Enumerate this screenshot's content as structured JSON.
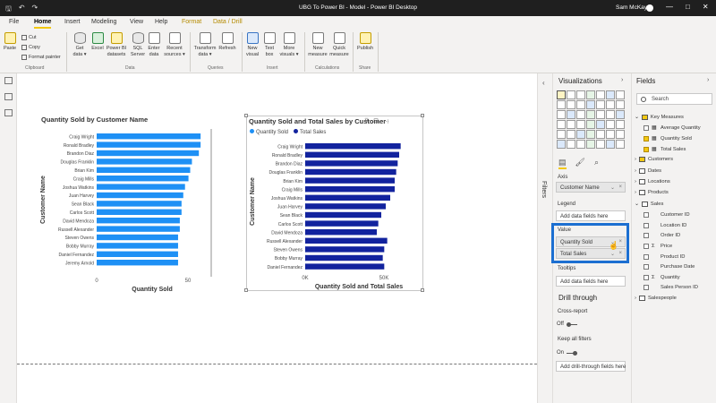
{
  "window": {
    "title": "UBG To Power BI - Model - Power BI Desktop",
    "user": "Sam McKay",
    "controls": [
      "—",
      "□",
      "✕"
    ]
  },
  "menu": {
    "tabs": [
      "File",
      "Home",
      "Insert",
      "Modeling",
      "View",
      "Help",
      "Format",
      "Data / Drill"
    ]
  },
  "ribbon": {
    "clipboard": {
      "paste": "Paste",
      "cut": "Cut",
      "copy": "Copy",
      "format_painter": "Format painter",
      "group": "Clipboard"
    },
    "data": {
      "buttons": [
        {
          "label": "Get\ndata ▾"
        },
        {
          "label": "Excel"
        },
        {
          "label": "Power BI\ndatasets"
        },
        {
          "label": "SQL\nServer"
        },
        {
          "label": "Enter\ndata"
        },
        {
          "label": "Recent\nsources ▾"
        }
      ],
      "group": "Data"
    },
    "queries": {
      "transform": "Transform\ndata ▾",
      "refresh": "Refresh",
      "group": "Queries"
    },
    "insert": {
      "new_visual": "New\nvisual",
      "text_box": "Text\nbox",
      "more_visuals": "More\nvisuals ▾",
      "group": "Insert"
    },
    "calculations": {
      "new_measure": "New\nmeasure",
      "quick_measure": "Quick\nmeasure",
      "group": "Calculations"
    },
    "share": {
      "publish": "Publish",
      "group": "Share"
    }
  },
  "chart1": {
    "title": "Quantity Sold by Customer Name",
    "ylabel": "Customer Name",
    "xlabel": "Quantity Sold",
    "ticks": [
      "0",
      "50"
    ]
  },
  "chart2": {
    "title": "Quantity Sold and Total Sales by Customer Name",
    "ylabel": "Customer Name",
    "xlabel": "Quantity Sold and Total Sales",
    "ticks": [
      "0K",
      "50K"
    ],
    "legend": [
      "Quantity Sold",
      "Total Sales"
    ]
  },
  "chart_data": [
    {
      "type": "bar",
      "orientation": "horizontal",
      "title": "Quantity Sold by Customer Name",
      "xlabel": "Quantity Sold",
      "ylabel": "Customer Name",
      "categories": [
        "Craig Wright",
        "Ronald Bradley",
        "Brandon Diaz",
        "Douglas Franklin",
        "Brian Kim",
        "Craig Mills",
        "Joshua Watkins",
        "Juan Harvey",
        "Sean Black",
        "Carlos Scott",
        "David Mendoza",
        "Russell Alexander",
        "Steven Owens",
        "Bobby Murray",
        "Daniel Fernandez",
        "Jeremy Arnold"
      ],
      "values": [
        60,
        60,
        59,
        55,
        54,
        53,
        51,
        50,
        49,
        49,
        48,
        48,
        47,
        47,
        47,
        47
      ],
      "xlim": [
        0,
        62
      ],
      "color": "#1e90f5"
    },
    {
      "type": "bar",
      "orientation": "horizontal",
      "title": "Quantity Sold and Total Sales by Customer Name",
      "xlabel": "Quantity Sold and Total Sales",
      "ylabel": "Customer Name",
      "categories": [
        "Craig Wright",
        "Ronald Bradley",
        "Brandon Diaz",
        "Douglas Franklin",
        "Brian Kim",
        "Craig Mills",
        "Joshua Watkins",
        "Juan Harvey",
        "Sean Black",
        "Carlos Scott",
        "David Mendoza",
        "Russell Alexander",
        "Steven Owens",
        "Bobby Murray",
        "Daniel Fernandez"
      ],
      "series": [
        {
          "name": "Quantity Sold",
          "values": [
            0.06,
            0.06,
            0.06,
            0.05,
            0.05,
            0.05,
            0.05,
            0.05,
            0.05,
            0.05,
            0.05,
            0.05,
            0.05,
            0.05,
            0.05
          ],
          "color": "#1e90f5"
        },
        {
          "name": "Total Sales",
          "values": [
            64000,
            63000,
            62000,
            61000,
            60000,
            60000,
            57000,
            54000,
            51000,
            49000,
            48000,
            55000,
            53000,
            52000,
            53000
          ],
          "color": "#12239e"
        }
      ],
      "xlim": [
        0,
        66000
      ]
    }
  ],
  "filters": {
    "label": "Filters",
    "arrow": "‹"
  },
  "visualizations": {
    "title": "Visualizations",
    "arrow": "›",
    "axis_label": "Axis",
    "axis_field": "Customer Name",
    "legend_label": "Legend",
    "legend_placeholder": "Add data fields here",
    "value_label": "Value",
    "value_fields": [
      "Quantity Sold",
      "Total Sales"
    ],
    "tooltips_label": "Tooltips",
    "tooltips_placeholder": "Add data fields here",
    "drill_title": "Drill through",
    "cross_report": "Cross-report",
    "cross_report_state": "Off",
    "keep_filters": "Keep all filters",
    "keep_filters_state": "On",
    "drill_placeholder": "Add drill-through fields here"
  },
  "fields": {
    "title": "Fields",
    "arrow": "›",
    "search_placeholder": "Search",
    "tree": [
      {
        "label": "Key Measures",
        "kind": "table-yellow",
        "level": 0,
        "expanded": true
      },
      {
        "label": "Average Quantity",
        "kind": "measure",
        "level": 1,
        "checked": false
      },
      {
        "label": "Quantity Sold",
        "kind": "measure",
        "level": 1,
        "checked": true
      },
      {
        "label": "Total Sales",
        "kind": "measure",
        "level": 1,
        "checked": true
      },
      {
        "label": "Customers",
        "kind": "table-yellow",
        "level": 0,
        "expanded": false
      },
      {
        "label": "Dates",
        "kind": "table",
        "level": 0,
        "expanded": false
      },
      {
        "label": "Locations",
        "kind": "table",
        "level": 0,
        "expanded": false
      },
      {
        "label": "Products",
        "kind": "table",
        "level": 0,
        "expanded": false
      },
      {
        "label": "Sales",
        "kind": "table",
        "level": 0,
        "expanded": true
      },
      {
        "label": "Customer ID",
        "kind": "field",
        "level": 1,
        "checked": false
      },
      {
        "label": "Location ID",
        "kind": "field",
        "level": 1,
        "checked": false
      },
      {
        "label": "Order ID",
        "kind": "field",
        "level": 1,
        "checked": false
      },
      {
        "label": "Price",
        "kind": "sum",
        "level": 1,
        "checked": false
      },
      {
        "label": "Product ID",
        "kind": "field",
        "level": 1,
        "checked": false
      },
      {
        "label": "Purchase Date",
        "kind": "field",
        "level": 1,
        "checked": false
      },
      {
        "label": "Quantity",
        "kind": "sum",
        "level": 1,
        "checked": false
      },
      {
        "label": "Sales Person ID",
        "kind": "field",
        "level": 1,
        "checked": false
      },
      {
        "label": "Salespeople",
        "kind": "table",
        "level": 0,
        "expanded": false
      }
    ]
  },
  "colors": {
    "accent": "#f2c811",
    "bar_light": "#1e90f5",
    "bar_dark": "#12239e",
    "highlight": "#1c6fd1"
  }
}
